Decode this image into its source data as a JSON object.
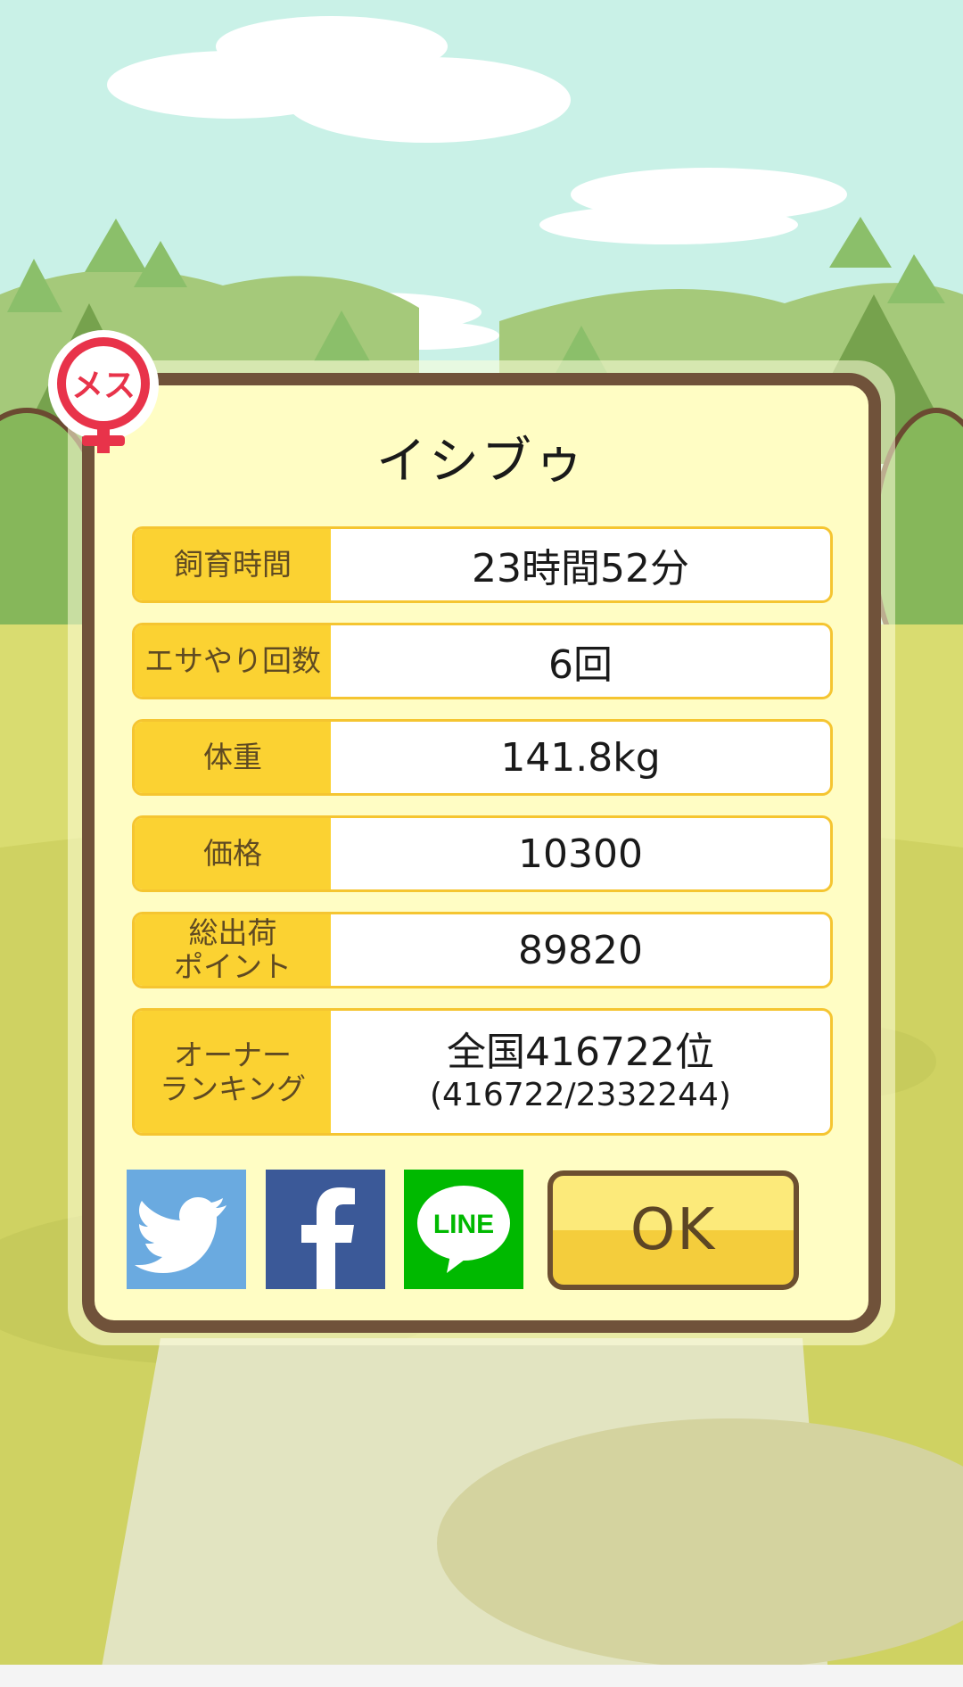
{
  "badge": {
    "label": "メス"
  },
  "dialog": {
    "title": "イシブゥ",
    "rows": [
      {
        "label": "飼育時間",
        "value": "23時間52分"
      },
      {
        "label": "エサやり回数",
        "value": "6回"
      },
      {
        "label": "体重",
        "value": "141.8kg"
      },
      {
        "label": "価格",
        "value": "10300"
      },
      {
        "label_line1": "総出荷",
        "label_line2": "ポイント",
        "value": "89820"
      },
      {
        "label_line1": "オーナー",
        "label_line2": "ランキング",
        "value_main": "全国416722位",
        "value_sub": "(416722/2332244)"
      }
    ],
    "share": {
      "twitter_icon": "twitter-bird-icon",
      "facebook_icon": "facebook-f-icon",
      "line_label": "LINE"
    },
    "ok_label": "OK"
  },
  "colors": {
    "frame": "#70523a",
    "panel": "#fffdc4",
    "label_bg": "#fbd232",
    "twitter": "#6aaae0",
    "facebook": "#3b5998",
    "line": "#00b900"
  }
}
